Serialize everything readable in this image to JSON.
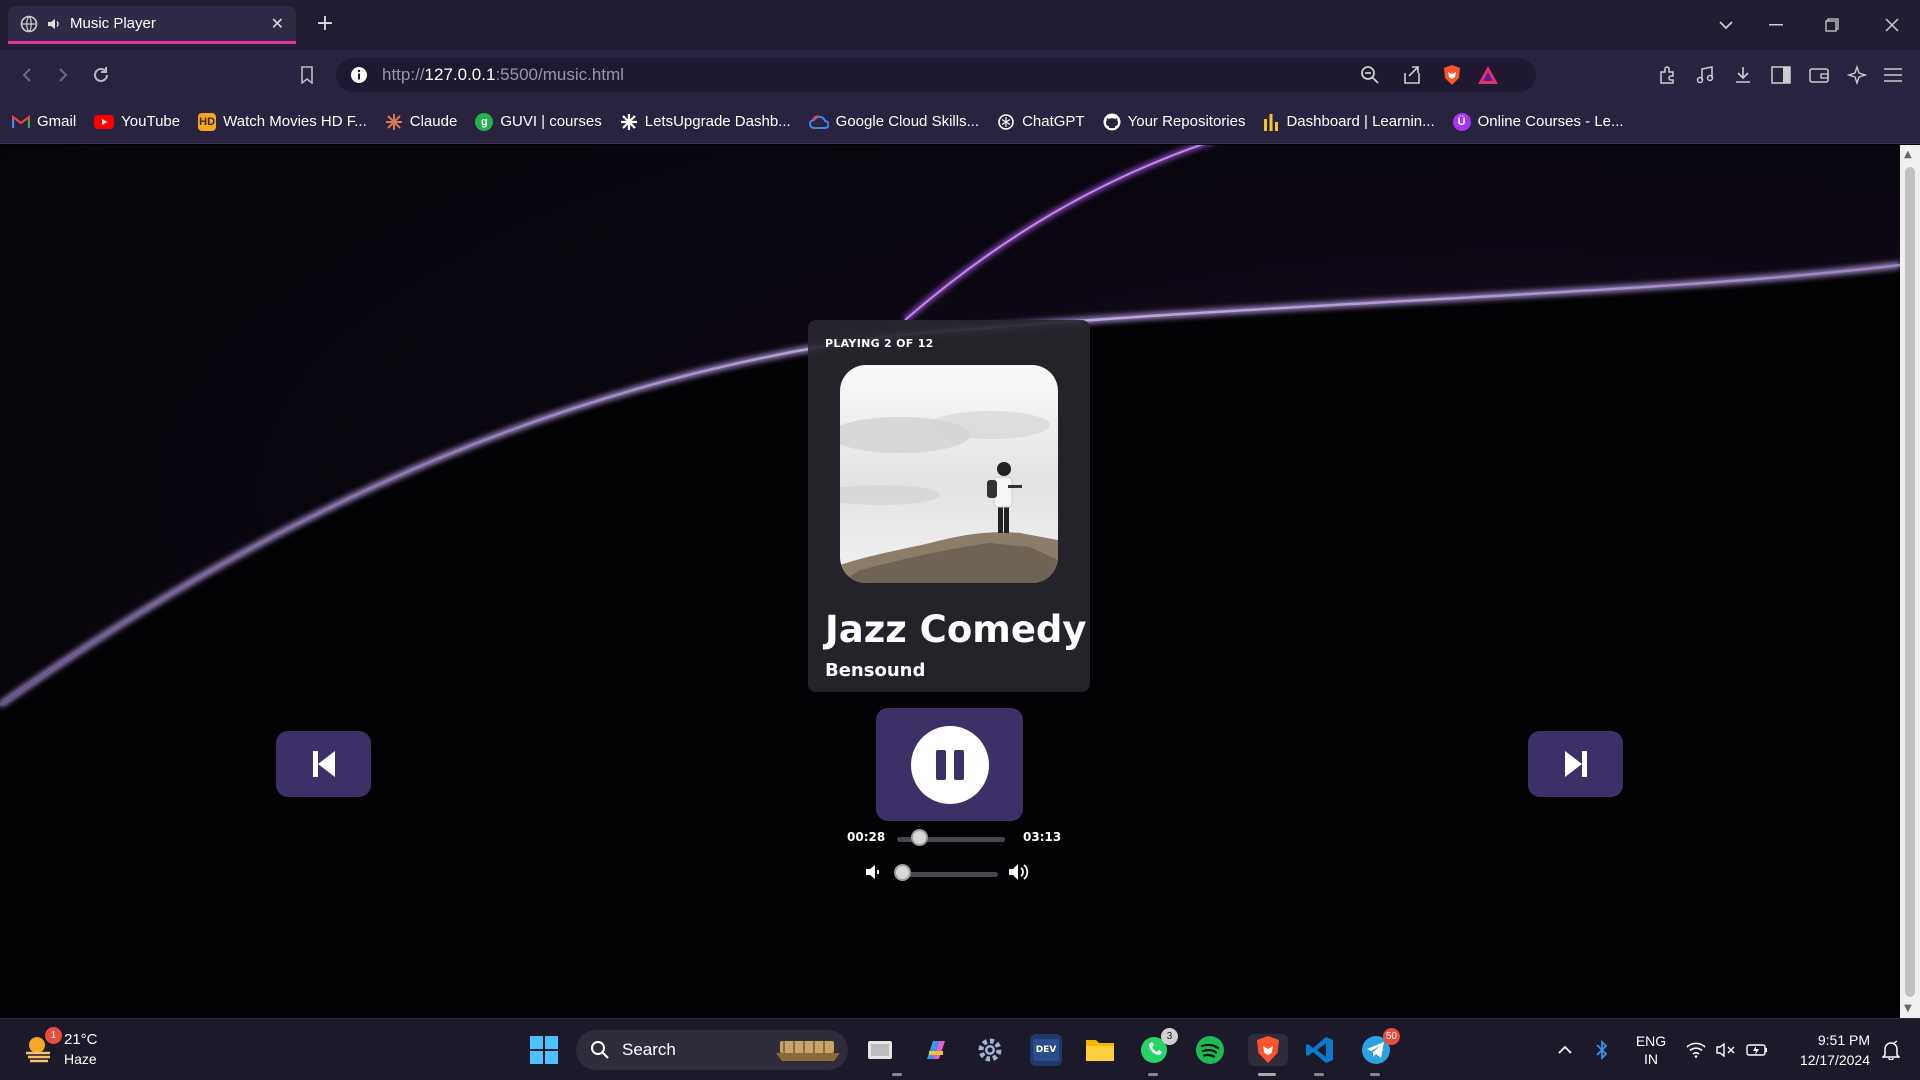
{
  "browser": {
    "tab_title": "Music Player",
    "url": {
      "proto": "http://",
      "host": "127.0.0.1",
      "rest": ":5500/music.html"
    },
    "bookmarks": [
      {
        "label": "Gmail",
        "icon": "gmail-icon",
        "color": "#ea4335"
      },
      {
        "label": "YouTube",
        "icon": "youtube-icon",
        "color": "#ff0000"
      },
      {
        "label": "Watch Movies HD F...",
        "icon": "hd-icon",
        "color": "#f5a623"
      },
      {
        "label": "Claude",
        "icon": "claude-icon",
        "color": "#d97757"
      },
      {
        "label": "GUVI | courses",
        "icon": "guvi-icon",
        "color": "#22b14c"
      },
      {
        "label": "LetsUpgrade Dashb...",
        "icon": "letsupgrade-icon",
        "color": "#ffffff"
      },
      {
        "label": "Google Cloud Skills...",
        "icon": "google-cloud-icon",
        "color": "#4285f4"
      },
      {
        "label": "ChatGPT",
        "icon": "chatgpt-icon",
        "color": "#ffffff"
      },
      {
        "label": "Your Repositories",
        "icon": "github-icon",
        "color": "#ffffff"
      },
      {
        "label": "Dashboard | Learnin...",
        "icon": "dashboard-icon",
        "color": "#f4c430"
      },
      {
        "label": "Online Courses - Le...",
        "icon": "udemy-icon",
        "color": "#a435f0"
      }
    ]
  },
  "player": {
    "status": "PLAYING 2 OF 12",
    "song": "Jazz Comedy",
    "artist": "Bensound",
    "current_time": "00:28",
    "total_time": "03:13",
    "progress_fraction": 0.15,
    "volume_fraction": 0.0
  },
  "taskbar": {
    "weather_temp": "21°C",
    "weather_desc": "Haze",
    "weather_badge": "1",
    "search_label": "Search",
    "whatsapp_badge": "3",
    "telegram_badge": "50",
    "lang_top": "ENG",
    "lang_bottom": "IN",
    "time": "9:51 PM",
    "date": "12/17/2024"
  },
  "colors": {
    "accent_tab": "#e0359f",
    "control_bg": "#3d3066",
    "card_bg": "#28262e"
  }
}
